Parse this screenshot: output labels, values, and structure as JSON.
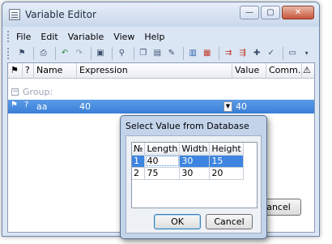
{
  "window": {
    "title": "Variable Editor",
    "buttons": {
      "minimize": "—",
      "maximize": "▢",
      "close": "✕"
    }
  },
  "menu": [
    "File",
    "Edit",
    "Variable",
    "View",
    "Help"
  ],
  "toolbar_icons": [
    "var-icon",
    "print-icon",
    "undo-icon",
    "redo-icon",
    "expression-icon",
    "find-icon",
    "copy-icon",
    "paste-icon",
    "clear-icon",
    "tree-icon",
    "grid-icon",
    "import-icon",
    "export-icon",
    "var-add-icon",
    "var-value-icon",
    "properties-icon"
  ],
  "grid": {
    "columns": {
      "flag": "⚑",
      "q": "?",
      "name": "Name",
      "expression": "Expression",
      "value": "Value",
      "comment": "Comm...",
      "warning": "⚠"
    },
    "group": {
      "expander": "−",
      "label": "Group:"
    },
    "selected_row": {
      "flag": "⚑",
      "q": "?",
      "name": "aa",
      "expression": "40",
      "value": "40"
    }
  },
  "background_button": {
    "label": "Cancel",
    "visible_text": "ancel"
  },
  "dialog": {
    "title": "Select Value from Database",
    "table": {
      "headers": [
        "№",
        "Length",
        "Width",
        "Height"
      ],
      "rows": [
        [
          "1",
          "40",
          "30",
          "15"
        ],
        [
          "2",
          "75",
          "30",
          "20"
        ]
      ],
      "selected_row_index": 0
    },
    "ok_label": "OK",
    "cancel_label": "Cancel"
  },
  "colors": {
    "selection": "#3a7fd9",
    "window_bg": "#dbe6f4",
    "dialog_bg": "#c2d3ea"
  }
}
